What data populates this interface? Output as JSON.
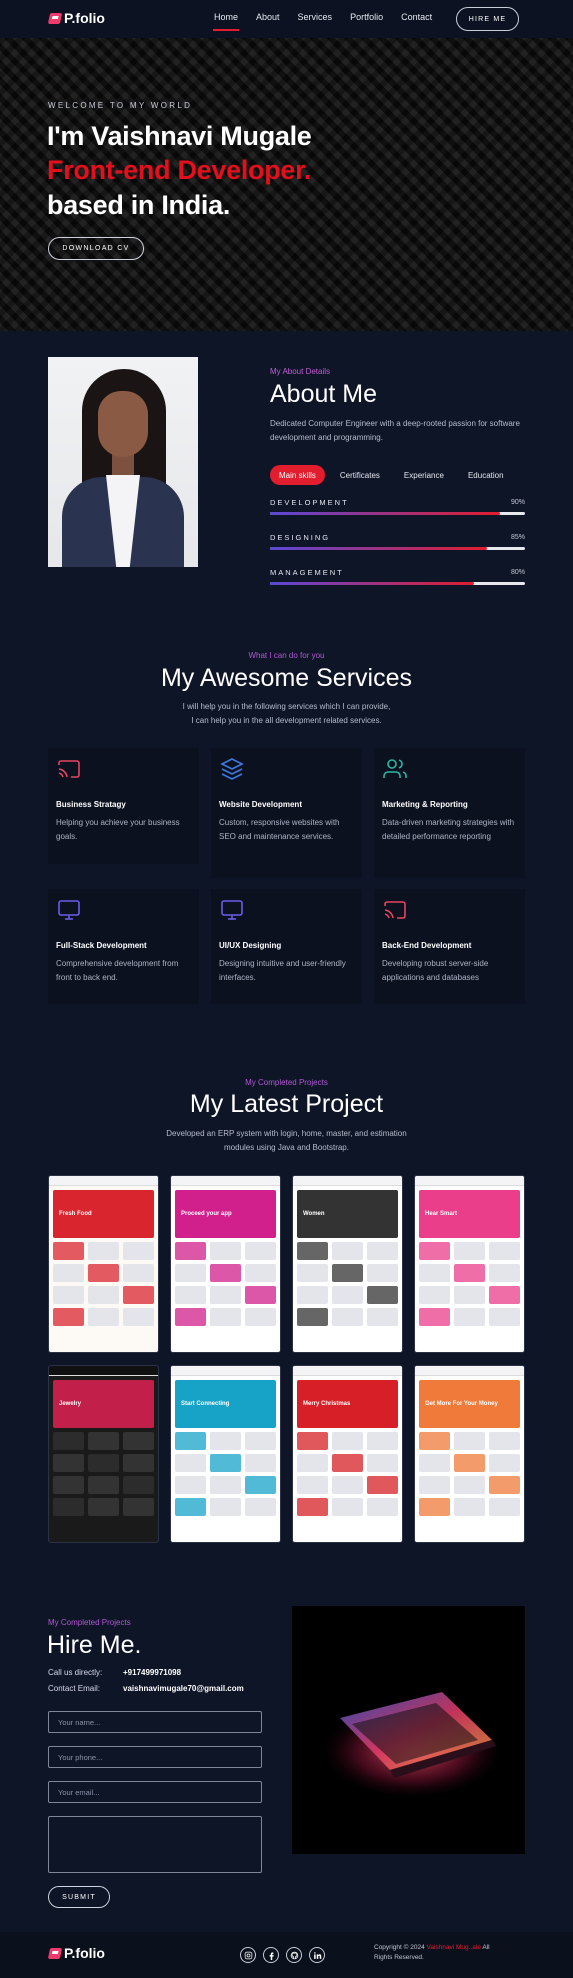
{
  "nav": {
    "logo": "P.folio",
    "links": [
      "Home",
      "About",
      "Services",
      "Portfolio",
      "Contact"
    ],
    "hire_label": "HIRE ME"
  },
  "hero": {
    "kicker": "WELCOME TO MY WORLD",
    "line1": "I'm Vaishnavi Mugale",
    "line2": "Front-end Developer.",
    "line3": "based in India.",
    "button": "DOWNLOAD CV"
  },
  "about": {
    "kicker": "My About Details",
    "title": "About Me",
    "desc": "Dedicated Computer Engineer with a deep-rooted passion for software development and programming.",
    "tabs": [
      "Main skills",
      "Certificates",
      "Experiance",
      "Education"
    ],
    "skills": [
      {
        "name": "DEVELOPMENT",
        "pct": "90%",
        "value": 90
      },
      {
        "name": "DESIGNING",
        "pct": "85%",
        "value": 85
      },
      {
        "name": "MANAGEMENT",
        "pct": "80%",
        "value": 80
      }
    ]
  },
  "services": {
    "kicker": "What I can do for you",
    "title": "My Awesome Services",
    "desc1": "I will help you in the following services which I can provide,",
    "desc2": "I can help you in the all development related services.",
    "items": [
      {
        "title": "Business Stratagy",
        "text": "Helping you achieve your business goals.",
        "icon": "cast-icon",
        "color": "#e8455e"
      },
      {
        "title": "Website Development",
        "text": "Custom, responsive websites with SEO and maintenance services.",
        "icon": "layers-icon",
        "color": "#3d7be3"
      },
      {
        "title": "Marketing & Reporting",
        "text": "Data-driven marketing strategies with detailed performance reporting",
        "icon": "users-icon",
        "color": "#2bb7a3"
      },
      {
        "title": "Full-Stack Development",
        "text": "Comprehensive development from front to back end.",
        "icon": "monitor-icon",
        "color": "#6d5ce8"
      },
      {
        "title": "UI/UX Designing",
        "text": "Designing intuitive and user-friendly interfaces.",
        "icon": "monitor-icon",
        "color": "#6d5ce8"
      },
      {
        "title": "Back-End Development",
        "text": "Developing robust server-side applications and databases",
        "icon": "cast-icon",
        "color": "#e8455e"
      }
    ]
  },
  "projects": {
    "kicker": "My Completed Projects",
    "title": "My Latest Project",
    "desc1": "Developed an ERP system with login, home, master, and estimation",
    "desc2": "modules using Java and Bootstrap.",
    "thumbs": [
      {
        "name": "food-site-thumbnail",
        "text": "Fresh Food",
        "accent": "#d9262e",
        "bg": "#fdfaf5"
      },
      {
        "name": "app-landing-thumbnail",
        "text": "Proceed your app",
        "accent": "#d11f8c",
        "bg": "#ffffff"
      },
      {
        "name": "fashion-store-thumbnail",
        "text": "Women",
        "accent": "#333333",
        "bg": "#ffffff"
      },
      {
        "name": "audio-store-thumbnail",
        "text": "Hear Smart",
        "accent": "#ea3d8a",
        "bg": "#ffffff"
      },
      {
        "name": "jewelry-store-thumbnail",
        "text": "Jewelry",
        "accent": "#c21f4a",
        "bg": "#1a1a1a"
      },
      {
        "name": "social-app-thumbnail",
        "text": "Start Connecting",
        "accent": "#17a3c8",
        "bg": "#ffffff"
      },
      {
        "name": "christmas-thumbnail",
        "text": "Merry Christmas",
        "accent": "#d61f26",
        "bg": "#ffffff"
      },
      {
        "name": "finance-thumbnail",
        "text": "Get More For Your Money",
        "accent": "#f07a3a",
        "bg": "#ffffff"
      }
    ]
  },
  "hire": {
    "kicker": "My Completed Projects",
    "title": "Hire Me.",
    "call_label": "Call us directly:",
    "call_value": "+917499971098",
    "email_label": "Contact Email:",
    "email_value": "vaishnavimugale70@gmail.com",
    "name_placeholder": "Your name...",
    "phone_placeholder": "Your phone...",
    "email_placeholder": "Your email...",
    "submit": "SUBMIT"
  },
  "footer": {
    "logo": "P.folio",
    "copyright": "Copyright © 2024",
    "brand": "Vaishnavi Mug..ale",
    "rights_tail": "All",
    "rights": "Rights Reserved.",
    "socials": [
      "instagram-icon",
      "facebook-icon",
      "github-icon",
      "linkedin-icon"
    ]
  }
}
